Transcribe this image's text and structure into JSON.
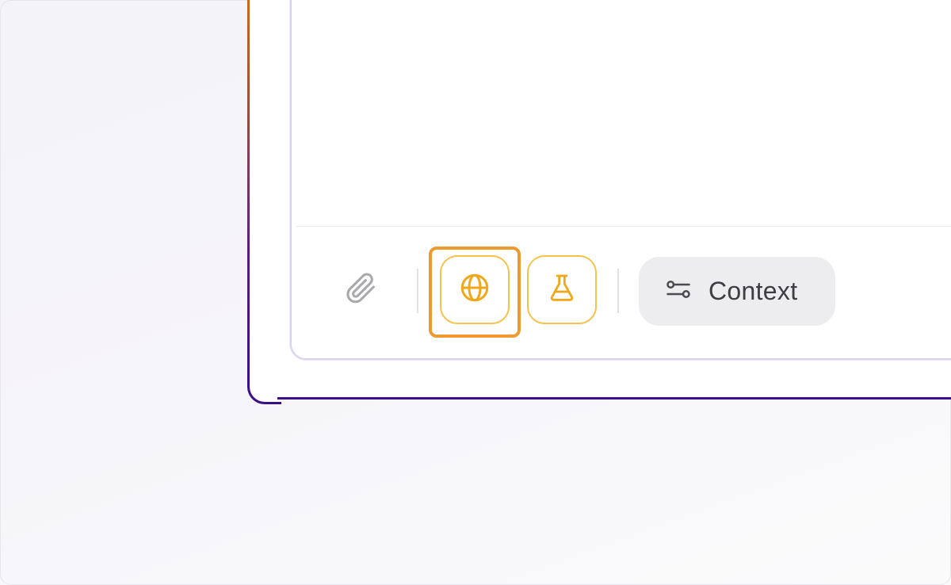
{
  "toolbar": {
    "attach_icon": "paperclip-icon",
    "web_search_icon": "globe-icon",
    "experiment_icon": "flask-icon",
    "context_icon": "sliders-icon",
    "context_label": "Context"
  },
  "colors": {
    "accent_amber": "#f7c24a",
    "highlight_orange": "#ef9a2f",
    "frame_gradient_top": "#d06a14",
    "frame_gradient_bottom": "#3a0f8a",
    "inner_border": "#dcd0ef",
    "context_bg": "#ededef"
  }
}
